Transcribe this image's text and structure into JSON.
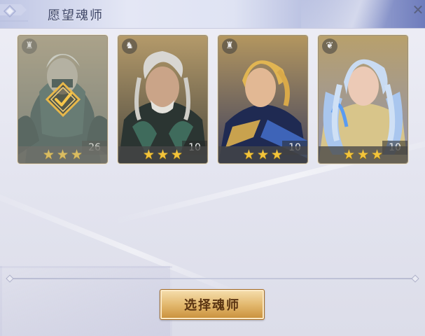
{
  "window": {
    "title": "愿望魂师"
  },
  "cards": [
    {
      "faction_icon": "tower-icon",
      "level": "26",
      "stars": 3,
      "selected": true
    },
    {
      "faction_icon": "bird-icon",
      "level": "10",
      "stars": 3,
      "selected": false
    },
    {
      "faction_icon": "tower-icon",
      "level": "10",
      "stars": 3,
      "selected": false
    },
    {
      "faction_icon": "wing-icon",
      "level": "10",
      "stars": 3,
      "selected": false
    }
  ],
  "action": {
    "select_label": "选择魂师"
  },
  "colors": {
    "star": "#f3c43b",
    "button_gold": "#e3b96f",
    "title_text": "#3c4466"
  }
}
